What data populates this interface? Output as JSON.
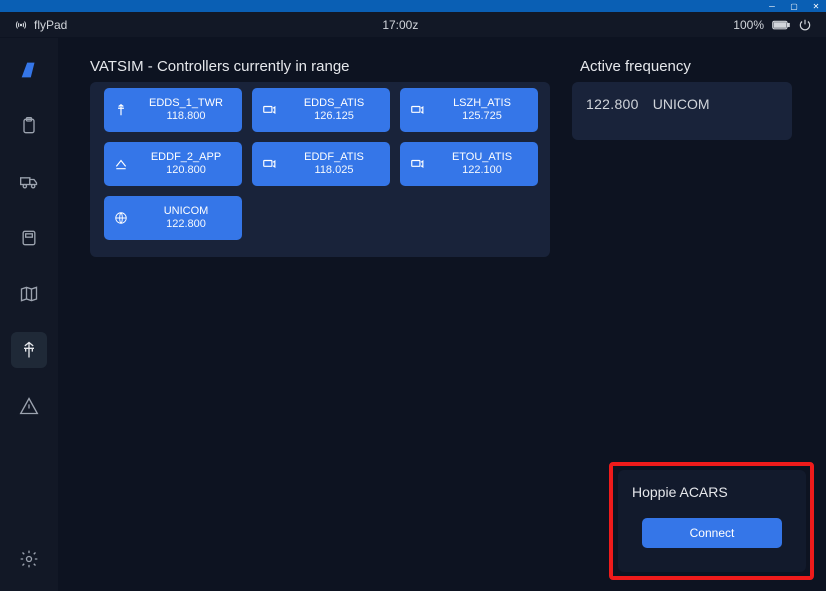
{
  "window": {
    "title": "flyPad"
  },
  "statusbar": {
    "app_name": "flyPad",
    "time": "17:00z",
    "battery_pct": "100%"
  },
  "sidebar": {
    "items": [
      {
        "name": "dashboard",
        "icon": "tail-icon"
      },
      {
        "name": "clipboard",
        "icon": "clipboard-icon"
      },
      {
        "name": "ground",
        "icon": "truck-icon"
      },
      {
        "name": "fuel",
        "icon": "fuel-icon"
      },
      {
        "name": "map",
        "icon": "map-icon"
      },
      {
        "name": "atc",
        "icon": "atc-icon",
        "active": true
      },
      {
        "name": "failures",
        "icon": "warning-icon"
      }
    ],
    "settings_label": "settings"
  },
  "section_titles": {
    "controllers": "VATSIM - Controllers currently in range",
    "active_frequency": "Active frequency",
    "hoppie": "Hoppie ACARS"
  },
  "controllers": [
    {
      "icon": "tower",
      "name": "EDDS_1_TWR",
      "freq": "118.800"
    },
    {
      "icon": "atis",
      "name": "EDDS_ATIS",
      "freq": "126.125"
    },
    {
      "icon": "atis",
      "name": "LSZH_ATIS",
      "freq": "125.725"
    },
    {
      "icon": "approach",
      "name": "EDDF_2_APP",
      "freq": "120.800"
    },
    {
      "icon": "atis",
      "name": "EDDF_ATIS",
      "freq": "118.025"
    },
    {
      "icon": "atis",
      "name": "ETOU_ATIS",
      "freq": "122.100"
    },
    {
      "icon": "globe",
      "name": "UNICOM",
      "freq": "122.800"
    }
  ],
  "active_frequency": {
    "freq": "122.800",
    "name": "UNICOM"
  },
  "hoppie": {
    "connect_label": "Connect"
  }
}
